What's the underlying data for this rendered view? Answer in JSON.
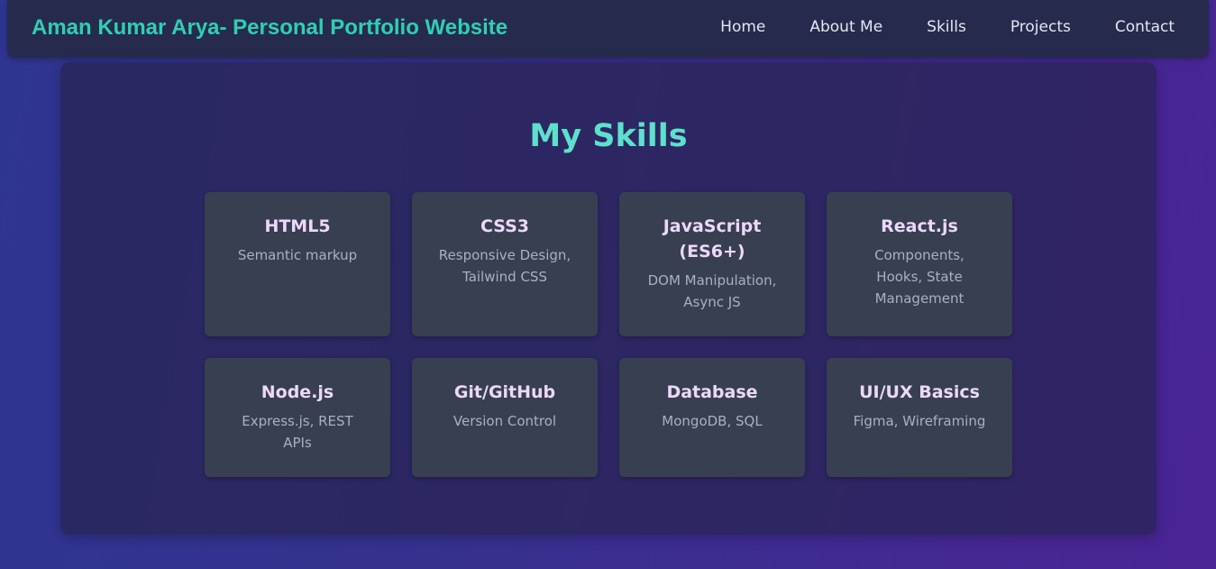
{
  "header": {
    "brand": "Aman Kumar Arya- Personal Portfolio Website",
    "nav": [
      {
        "label": "Home"
      },
      {
        "label": "About Me"
      },
      {
        "label": "Skills"
      },
      {
        "label": "Projects"
      },
      {
        "label": "Contact"
      }
    ]
  },
  "skills": {
    "title": "My Skills",
    "items": [
      {
        "name": "HTML5",
        "desc": "Semantic markup"
      },
      {
        "name": "CSS3",
        "desc": "Responsive Design, Tailwind CSS"
      },
      {
        "name": "JavaScript (ES6+)",
        "desc": "DOM Manipulation, Async JS"
      },
      {
        "name": "React.js",
        "desc": "Components, Hooks, State Management"
      },
      {
        "name": "Node.js",
        "desc": "Express.js, REST APIs"
      },
      {
        "name": "Git/GitHub",
        "desc": "Version Control"
      },
      {
        "name": "Database",
        "desc": "MongoDB, SQL"
      },
      {
        "name": "UI/UX Basics",
        "desc": "Figma, Wireframing"
      }
    ]
  },
  "colors": {
    "brand": "#2fcfb4",
    "title": "#5ee0cc",
    "card_bg": "#373f51",
    "card_title": "#ecd8f8",
    "card_desc": "#aab1bd"
  }
}
